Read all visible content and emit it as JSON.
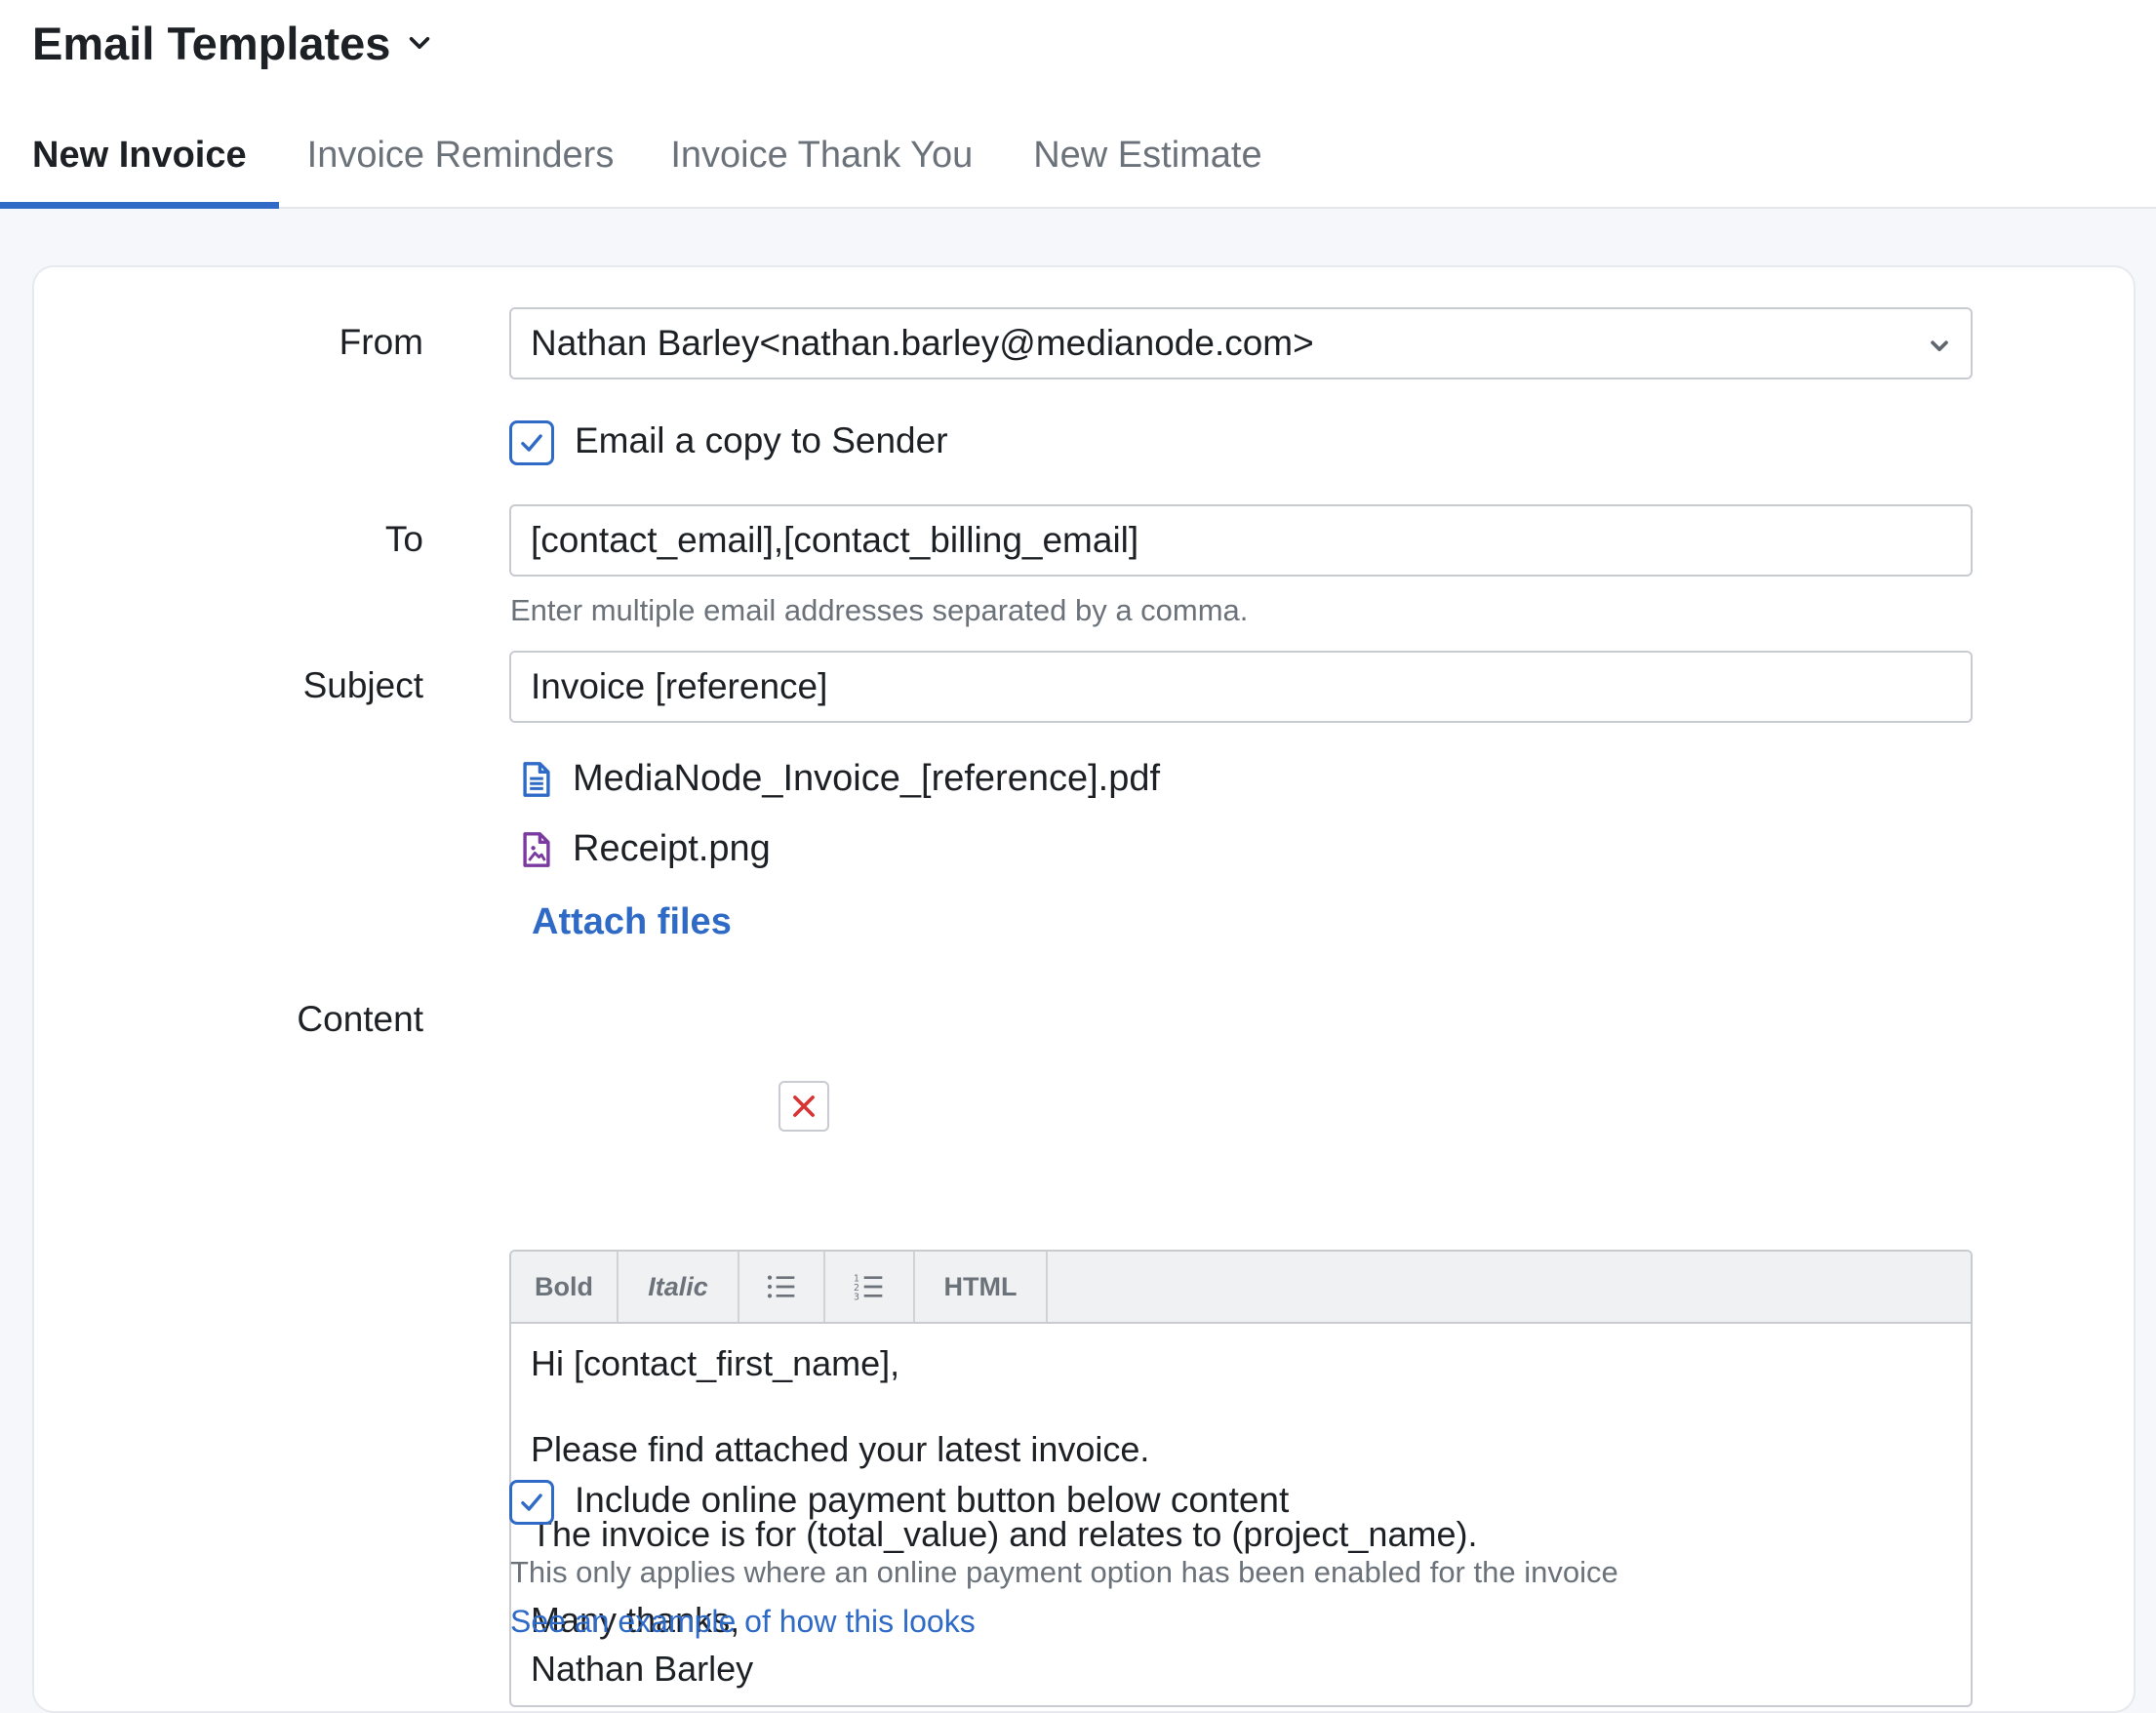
{
  "header": {
    "title": "Email Templates"
  },
  "tabs": [
    {
      "label": "New Invoice"
    },
    {
      "label": "Invoice Reminders"
    },
    {
      "label": "Invoice Thank You"
    },
    {
      "label": "New Estimate"
    }
  ],
  "form": {
    "from": {
      "label": "From",
      "value": "Nathan Barley<nathan.barley@medianode.com>"
    },
    "copy_sender": {
      "label": "Email a copy to Sender",
      "checked": true
    },
    "to": {
      "label": "To",
      "value": "[contact_email],[contact_billing_email]",
      "hint": "Enter multiple email addresses separated by a comma."
    },
    "subject": {
      "label": "Subject",
      "value": "Invoice [reference]"
    },
    "attachments": [
      {
        "name": "MediaNode_Invoice_[reference].pdf",
        "icon": "document-icon"
      },
      {
        "name": "Receipt.png",
        "icon": "image-file-icon"
      }
    ],
    "attach_link": "Attach files",
    "content": {
      "label": "Content",
      "toolbar": {
        "bold": "Bold",
        "italic": "Italic",
        "bullets": "bulleted-list-icon",
        "numbers": "numbered-list-icon",
        "html": "HTML"
      },
      "lines": [
        "Hi [contact_first_name],",
        "Please find attached your latest invoice.",
        "The invoice is for (total_value) and relates to (project_name).",
        "Many thanks,",
        "Nathan Barley"
      ]
    },
    "payment_button": {
      "label": "Include online payment button below content",
      "checked": true
    },
    "payment_hint": "This only applies where an online payment option has been enabled for the invoice",
    "example_link": "See an example of how this looks"
  },
  "colors": {
    "accent": "#2f6bc6",
    "remove": "#d93434",
    "image_icon": "#7a3aa0"
  }
}
